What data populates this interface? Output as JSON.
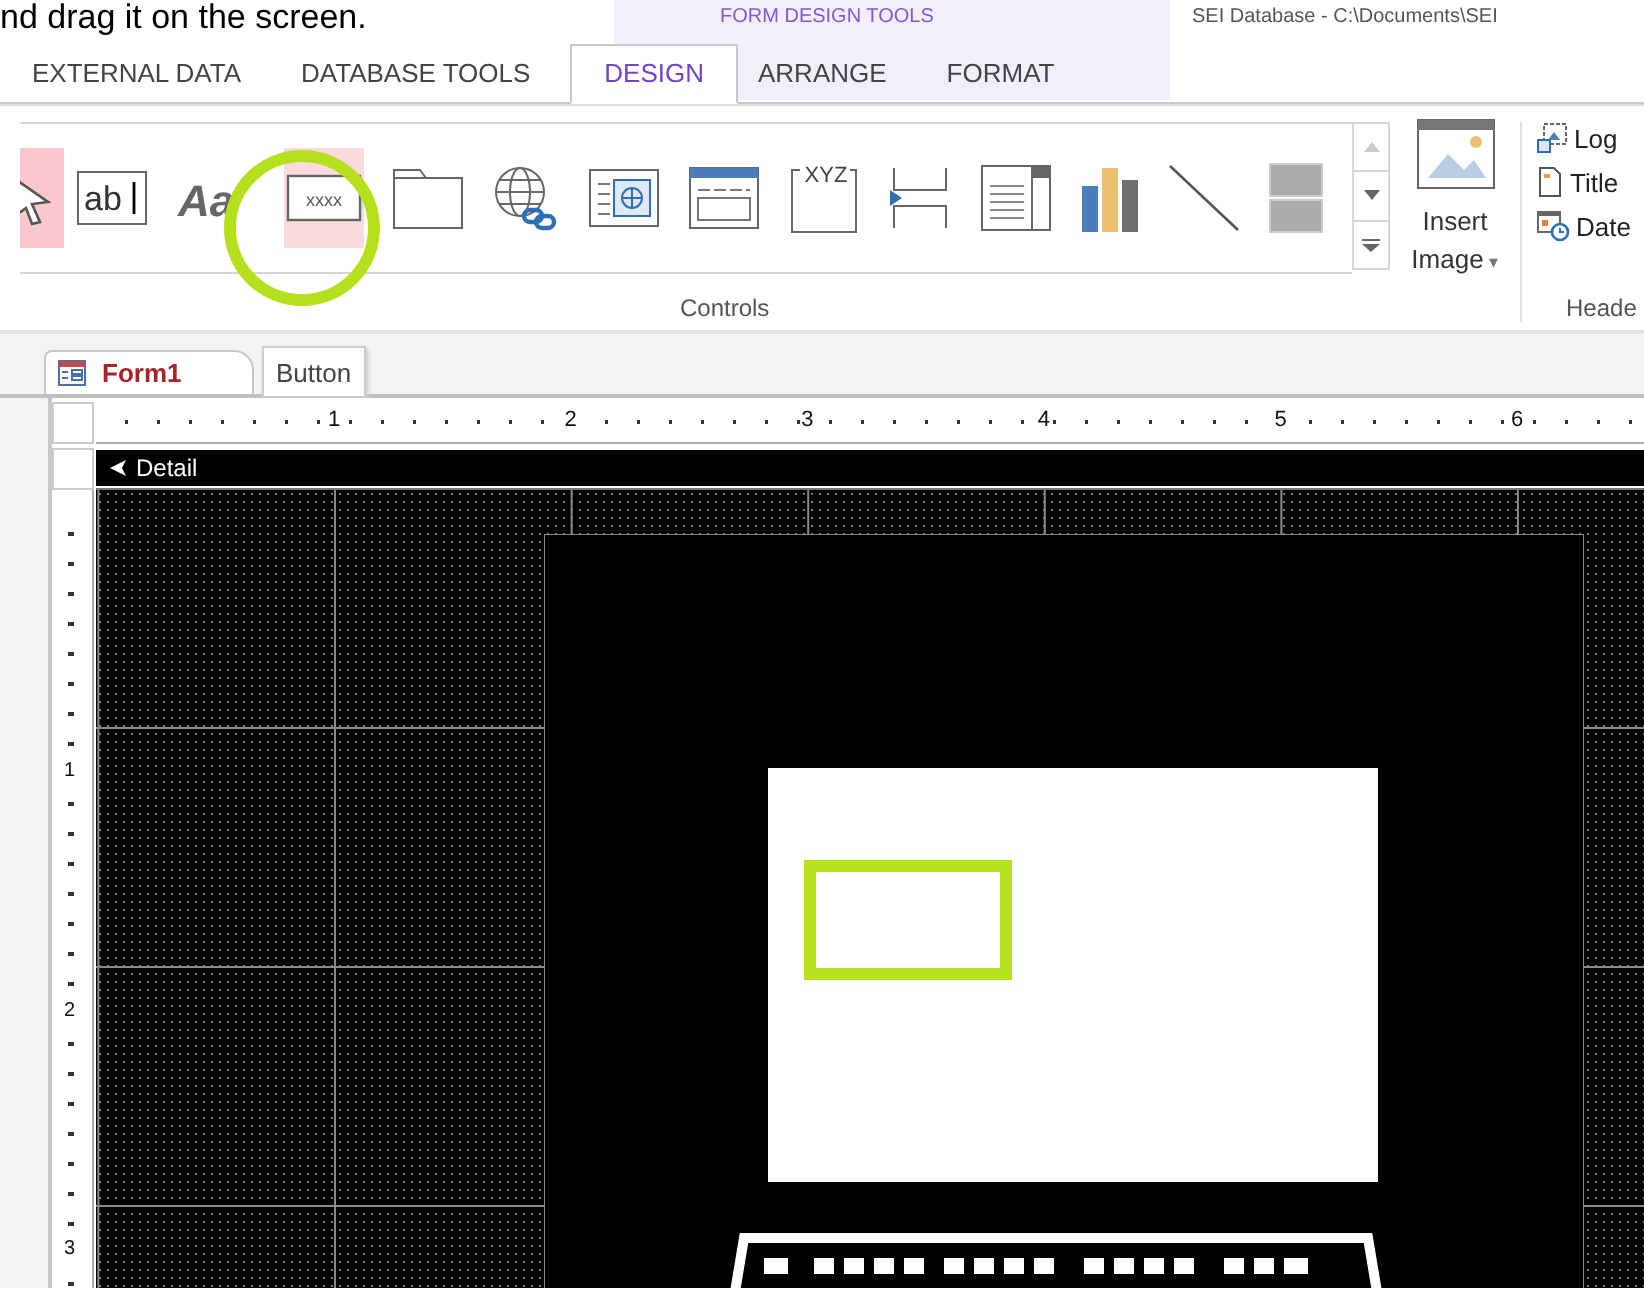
{
  "caption": "nd drag it on the screen.",
  "contextual_tab_group": "FORM DESIGN TOOLS",
  "window": {
    "title": "SEI Database - C:\\Documents\\SEI"
  },
  "tabs": [
    {
      "label": "EXTERNAL DATA",
      "selected": false
    },
    {
      "label": "DATABASE TOOLS",
      "selected": false
    },
    {
      "label": "DESIGN",
      "selected": true
    },
    {
      "label": "ARRANGE",
      "selected": false
    },
    {
      "label": "FORMAT",
      "selected": false
    }
  ],
  "ribbon": {
    "controls": [
      {
        "kind": "pointer",
        "selected": true
      },
      {
        "kind": "textbox",
        "text": "ab",
        "selected": false
      },
      {
        "kind": "label",
        "text": "Aa",
        "selected": false
      },
      {
        "kind": "button",
        "text": "xxxx",
        "selected": true
      },
      {
        "kind": "tab",
        "selected": false
      },
      {
        "kind": "hyperlink",
        "selected": false
      },
      {
        "kind": "browser",
        "selected": false
      },
      {
        "kind": "navigation",
        "selected": false
      },
      {
        "kind": "group",
        "text": "XYZ",
        "selected": false
      },
      {
        "kind": "pagebreak",
        "selected": false
      },
      {
        "kind": "list",
        "selected": false
      },
      {
        "kind": "chart",
        "selected": false
      },
      {
        "kind": "line",
        "selected": false
      },
      {
        "kind": "toggle",
        "selected": false
      }
    ],
    "insert_image": {
      "line1": "Insert",
      "line2": "Image",
      "caret": "▾"
    },
    "controls_group_label": "Controls",
    "header_items": [
      {
        "kind": "logo",
        "label": "Log"
      },
      {
        "kind": "title",
        "label": "Title"
      },
      {
        "kind": "date",
        "label": "Date"
      }
    ],
    "header_group_label": "Heade"
  },
  "document": {
    "tab": "Form1",
    "tooltip": "Button",
    "ruler_marks": [
      "1",
      "2",
      "3",
      "4",
      "5",
      "6"
    ],
    "vertical_ruler_marks": [
      "1",
      "2",
      "3"
    ],
    "section": "Detail"
  }
}
